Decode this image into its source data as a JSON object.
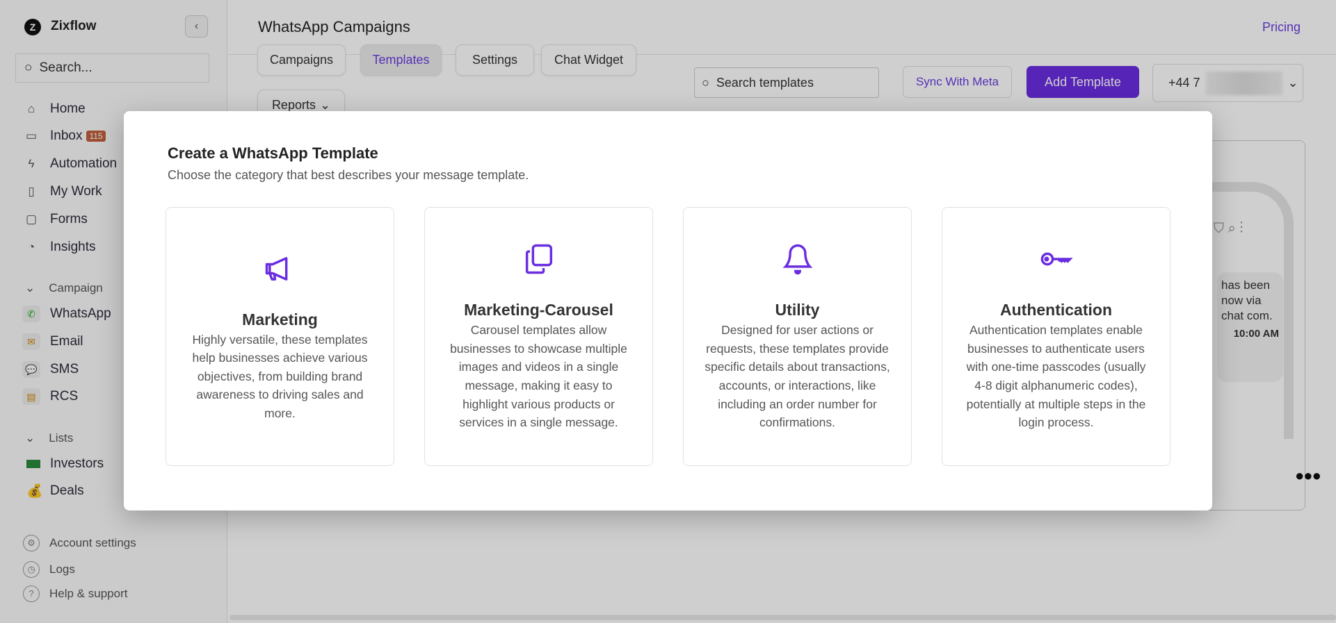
{
  "sidebar": {
    "brand": "Zixflow",
    "search_placeholder": "Search...",
    "nav": [
      {
        "label": "Home",
        "icon": "home-icon"
      },
      {
        "label": "Inbox",
        "icon": "inbox-icon",
        "badge": "115"
      },
      {
        "label": "Automation",
        "icon": "bolt-icon"
      },
      {
        "label": "My Work",
        "icon": "sidebar-icon"
      },
      {
        "label": "Forms",
        "icon": "file-icon"
      },
      {
        "label": "Insights",
        "icon": "pie-chart-icon"
      }
    ],
    "campaign_section": "Campaign",
    "channels": [
      {
        "label": "WhatsApp"
      },
      {
        "label": "Email"
      },
      {
        "label": "SMS"
      },
      {
        "label": "RCS"
      }
    ],
    "lists_section": "Lists",
    "lists": [
      {
        "label": "Investors"
      },
      {
        "label": "Deals"
      }
    ],
    "footer": [
      {
        "label": "Account settings"
      },
      {
        "label": "Logs"
      },
      {
        "label": "Help & support"
      }
    ]
  },
  "header": {
    "title": "WhatsApp Campaigns",
    "pricing": "Pricing",
    "tabs": [
      "Campaigns",
      "Templates",
      "Settings",
      "Chat Widget"
    ],
    "reports": "Reports",
    "search_placeholder": "Search templates",
    "sync": "Sync With Meta",
    "add": "Add Template",
    "phone_prefix": "+44 7"
  },
  "preview": {
    "message": "has been now via chat com.",
    "time": "10:00 AM"
  },
  "modal": {
    "title": "Create a WhatsApp Template",
    "subtitle": "Choose the category that best describes your message template.",
    "cards": [
      {
        "title": "Marketing",
        "desc": "Highly versatile, these templates help businesses achieve various objectives, from building brand awareness to driving sales and more."
      },
      {
        "title": "Marketing-Carousel",
        "desc": "Carousel templates allow businesses to showcase multiple images and videos in a single message, making it easy to highlight various products or services in a single message."
      },
      {
        "title": "Utility",
        "desc": "Designed for user actions or requests, these templates provide specific details about transactions, accounts, or interactions, like including an order number for confirmations."
      },
      {
        "title": "Authentication",
        "desc": "Authentication templates enable businesses to authenticate users with one-time passcodes (usually 4-8 digit alphanumeric codes), potentially at multiple steps in the login process."
      }
    ]
  },
  "colors": {
    "accent": "#6a2de0"
  }
}
